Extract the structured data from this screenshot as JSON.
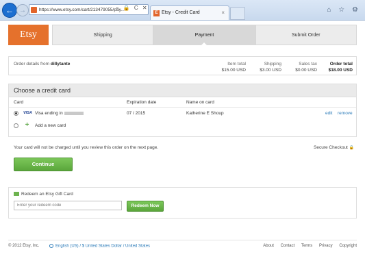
{
  "browser": {
    "url": "https://www.etsy.com/cart/213479055/pay...",
    "tab_title": "Etsy - Credit Card",
    "tab_close": "×",
    "back_symbol": "←",
    "forward_symbol": "→",
    "address_icons": "⌕ 🔒 C ✕",
    "right_icons": "⌂ ☆ ⚙",
    "tab_favicon_letter": "E"
  },
  "logo": "Etsy",
  "steps": [
    "Shipping",
    "Payment",
    "Submit Order"
  ],
  "active_step": "Payment",
  "summary": {
    "from_label": "Order details from",
    "shop": "dillytante",
    "item_total_label": "Item total",
    "item_total": "$15.00 USD",
    "shipping_label": "Shipping",
    "shipping": "$3.00 USD",
    "tax_label": "Sales tax",
    "tax": "$0.00 USD",
    "order_total_label": "Order total",
    "order_total": "$18.00 USD"
  },
  "credit_card": {
    "header": "Choose a credit card",
    "columns": {
      "card": "Card",
      "expiration": "Expiration date",
      "name": "Name on card"
    },
    "card": {
      "brand": "VISA",
      "label": "Visa ending in",
      "expiration": "07 / 2015",
      "name": "Katherine E Shoup",
      "edit": "edit",
      "remove": "remove"
    },
    "add_new": "Add a new card"
  },
  "notice": "Your card will not be charged until you review this order on the next page.",
  "secure_checkout": "Secure Checkout",
  "secure_icon": "🔒",
  "continue": "Continue",
  "gift": {
    "title": "Redeem an Etsy Gift Card",
    "placeholder": "Enter your redeem code",
    "button": "Redeem Now"
  },
  "footer": {
    "copyright": "© 2012 Etsy, Inc.",
    "locale": "English (US) / $ United States Dollar / United States",
    "links": [
      "About",
      "Contact",
      "Terms",
      "Privacy",
      "Copyright"
    ]
  },
  "colors": {
    "brand_orange": "#e5712c",
    "button_green": "#5aa63b",
    "link_blue": "#2a7ab8"
  }
}
